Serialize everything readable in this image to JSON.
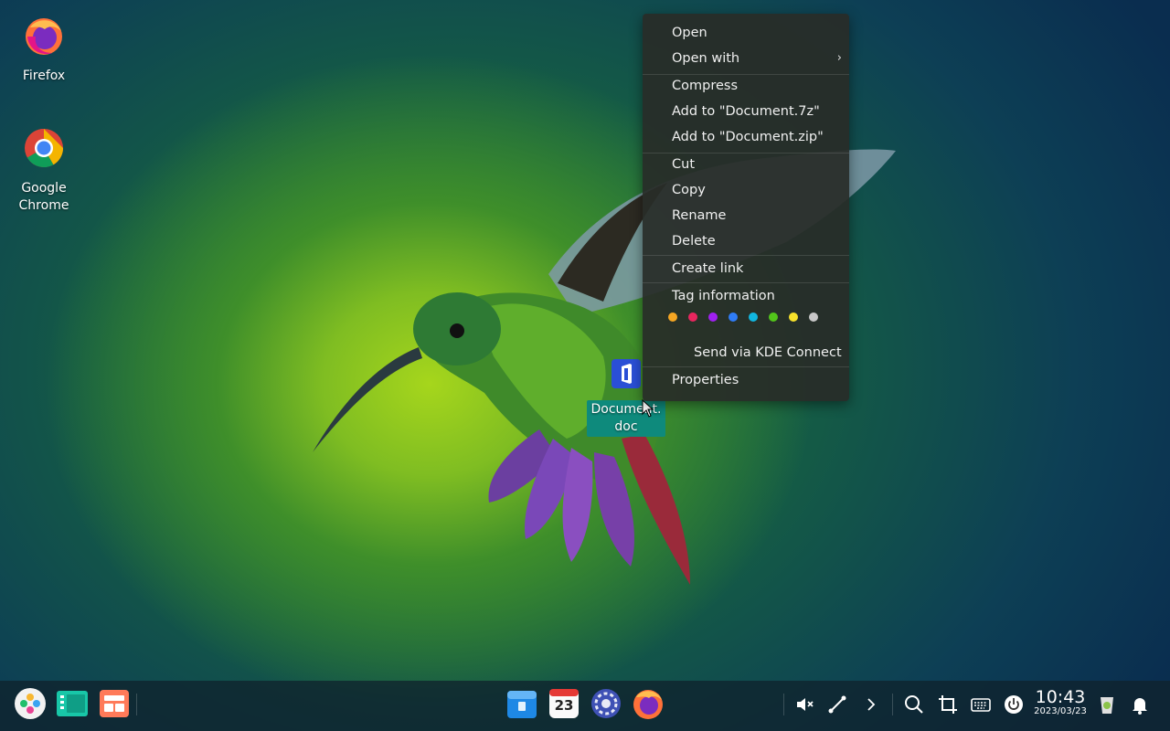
{
  "desktop": {
    "icons": [
      {
        "label": "Firefox"
      },
      {
        "label": "Google\nChrome"
      },
      {
        "label": "Document.\ndoc"
      }
    ]
  },
  "context_menu": {
    "items": {
      "open": "Open",
      "open_with": "Open with",
      "compress": "Compress",
      "add_7z": "Add to \"Document.7z\"",
      "add_zip": "Add to \"Document.zip\"",
      "cut": "Cut",
      "copy": "Copy",
      "rename": "Rename",
      "delete": "Delete",
      "create_link": "Create link",
      "tag_information": "Tag information",
      "send_kde": "Send via KDE Connect",
      "properties": "Properties"
    },
    "tag_colors": [
      "#f5a623",
      "#e8265e",
      "#a020f0",
      "#2f7cf6",
      "#11b6e0",
      "#52c41a",
      "#f7e22b",
      "#c8c8c8"
    ]
  },
  "taskbar": {
    "clock_time": "10:43",
    "clock_date": "2023/03/23",
    "calendar_day": "23"
  }
}
